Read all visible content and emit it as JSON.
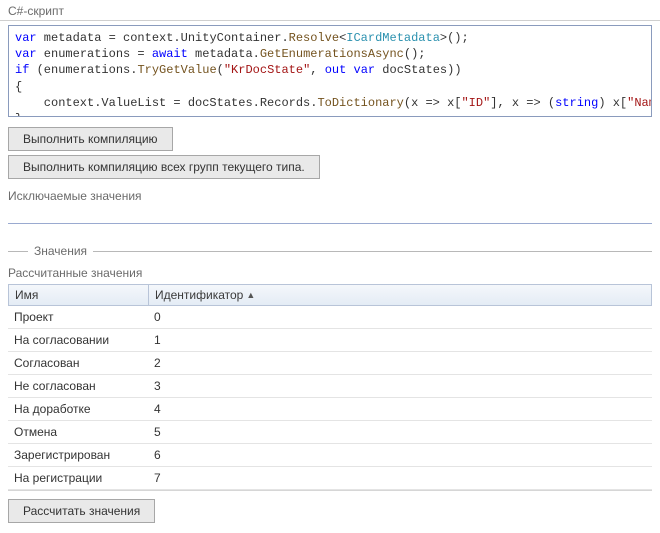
{
  "script_section": {
    "title": "C#-скрипт",
    "code_tokens": [
      [
        {
          "t": "var",
          "c": "kw"
        },
        {
          "t": " metadata = context.UnityContainer."
        },
        {
          "t": "Resolve",
          "c": "method"
        },
        {
          "t": "<"
        },
        {
          "t": "ICardMetadata",
          "c": "type"
        },
        {
          "t": ">();"
        }
      ],
      [
        {
          "t": "var",
          "c": "kw"
        },
        {
          "t": " enumerations = "
        },
        {
          "t": "await",
          "c": "kw"
        },
        {
          "t": " metadata."
        },
        {
          "t": "GetEnumerationsAsync",
          "c": "method"
        },
        {
          "t": "();"
        }
      ],
      [
        {
          "t": "if",
          "c": "kw"
        },
        {
          "t": " (enumerations."
        },
        {
          "t": "TryGetValue",
          "c": "method"
        },
        {
          "t": "("
        },
        {
          "t": "\"KrDocState\"",
          "c": "str"
        },
        {
          "t": ", "
        },
        {
          "t": "out",
          "c": "kw"
        },
        {
          "t": " "
        },
        {
          "t": "var",
          "c": "kw"
        },
        {
          "t": " docStates))"
        }
      ],
      [
        {
          "t": "{"
        }
      ],
      [
        {
          "t": "    context.ValueList = docStates.Records."
        },
        {
          "t": "ToDictionary",
          "c": "method"
        },
        {
          "t": "(x => x["
        },
        {
          "t": "\"ID\"",
          "c": "str"
        },
        {
          "t": "], x => ("
        },
        {
          "t": "string",
          "c": "kw"
        },
        {
          "t": ") x["
        },
        {
          "t": "\"Name\"",
          "c": "str"
        },
        {
          "t": "]);"
        }
      ],
      [
        {
          "t": "}"
        }
      ]
    ]
  },
  "buttons": {
    "compile": "Выполнить компиляцию",
    "compile_all": "Выполнить компиляцию всех групп текущего типа.",
    "calculate": "Рассчитать значения"
  },
  "excluded": {
    "label": "Исключаемые значения",
    "value": ""
  },
  "values_group": {
    "title": "Значения",
    "sub_label": "Рассчитанные значения",
    "columns": {
      "name": "Имя",
      "id": "Идентификатор"
    },
    "sort_indicator": "▲",
    "rows": [
      {
        "name": "Проект",
        "id": "0"
      },
      {
        "name": "На согласовании",
        "id": "1"
      },
      {
        "name": "Согласован",
        "id": "2"
      },
      {
        "name": "Не согласован",
        "id": "3"
      },
      {
        "name": "На доработке",
        "id": "4"
      },
      {
        "name": "Отмена",
        "id": "5"
      },
      {
        "name": "Зарегистрирован",
        "id": "6"
      },
      {
        "name": "На регистрации",
        "id": "7"
      }
    ]
  }
}
